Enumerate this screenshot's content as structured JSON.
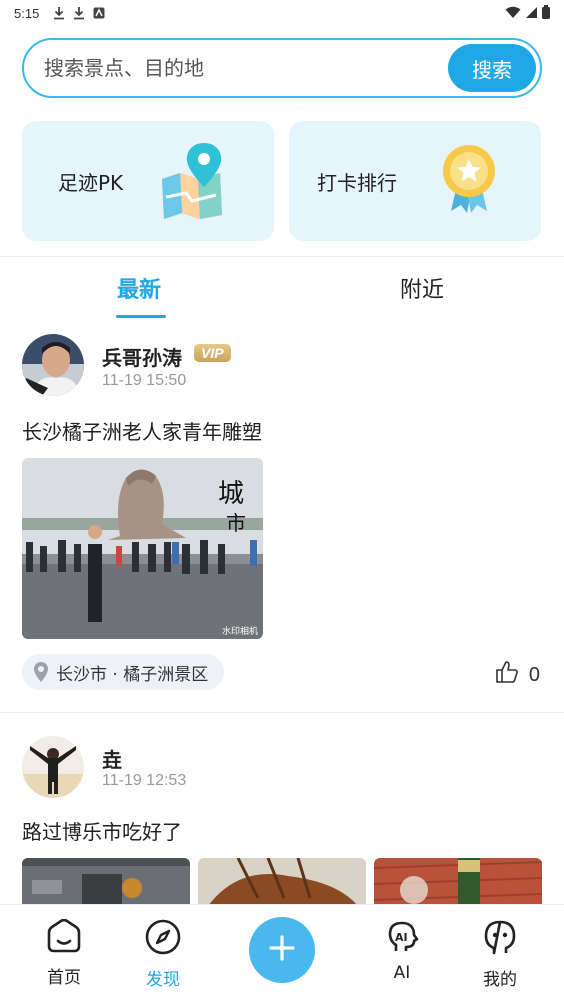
{
  "status_bar": {
    "time": "5:15"
  },
  "search": {
    "placeholder": "搜索景点、目的地",
    "button_label": "搜索"
  },
  "feature_cards": {
    "footprint_pk": "足迹PK",
    "checkin_rank": "打卡排行"
  },
  "tabs": {
    "latest": "最新",
    "nearby": "附近"
  },
  "posts": [
    {
      "username": "兵哥孙涛",
      "badge": "VIP",
      "time": "11-19 15:50",
      "text": "长沙橘子洲老人家青年雕塑",
      "photo_watermark": "水印相机",
      "location": "长沙市 · 橘子洲景区",
      "likes": "0"
    },
    {
      "username": "垚",
      "time": "11-19 12:53",
      "text": "路过博乐市吃好了"
    }
  ],
  "bottom_nav": {
    "home": "首页",
    "discover": "发现",
    "ai": "AI",
    "mine": "我的"
  },
  "colors": {
    "accent": "#1fa8e6",
    "card_bg": "#e6f5fc",
    "vip_gold": "#d4b06a"
  }
}
